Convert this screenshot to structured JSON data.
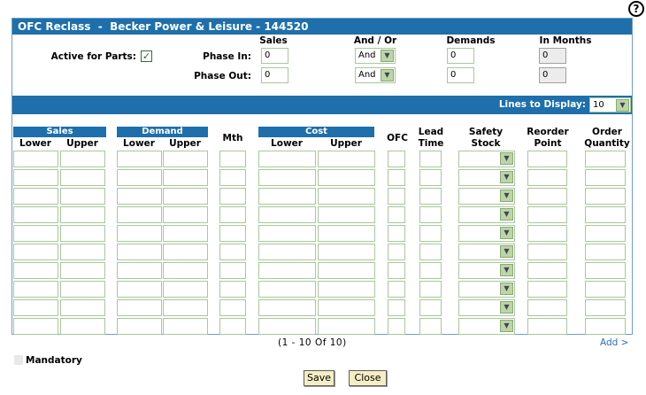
{
  "help": {
    "glyph": "?"
  },
  "title": "OFC Reclass  -  Becker Power & Leisure - 144520",
  "top_form": {
    "active_label": "Active for Parts:",
    "active_checked": true,
    "col_sales": "Sales",
    "col_andor": "And / Or",
    "col_demands": "Demands",
    "col_months": "In Months",
    "phase_in_label": "Phase In:",
    "phase_out_label": "Phase Out:",
    "phase_in": {
      "sales": "0",
      "andor": "And",
      "demands": "0",
      "months": "0"
    },
    "phase_out": {
      "sales": "0",
      "andor": "And",
      "demands": "0",
      "months": "0"
    }
  },
  "lines_to_display": {
    "label": "Lines to Display:",
    "value": "10"
  },
  "grid": {
    "sales": "Sales",
    "demand": "Demand",
    "cost": "Cost",
    "lower": "Lower",
    "upper": "Upper",
    "mth": "Mth",
    "ofc": "OFC",
    "lead": "Lead",
    "time": "Time",
    "safety": "Safety",
    "stock": "Stock",
    "reorder": "Reorder",
    "point": "Point",
    "order": "Order",
    "quantity": "Quantity",
    "row_count": 10
  },
  "pagination": "(1  -  10  Of  10)",
  "add_link": "Add >",
  "legend": {
    "mandatory": "Mandatory"
  },
  "buttons": {
    "save": "Save",
    "close": "Close"
  }
}
